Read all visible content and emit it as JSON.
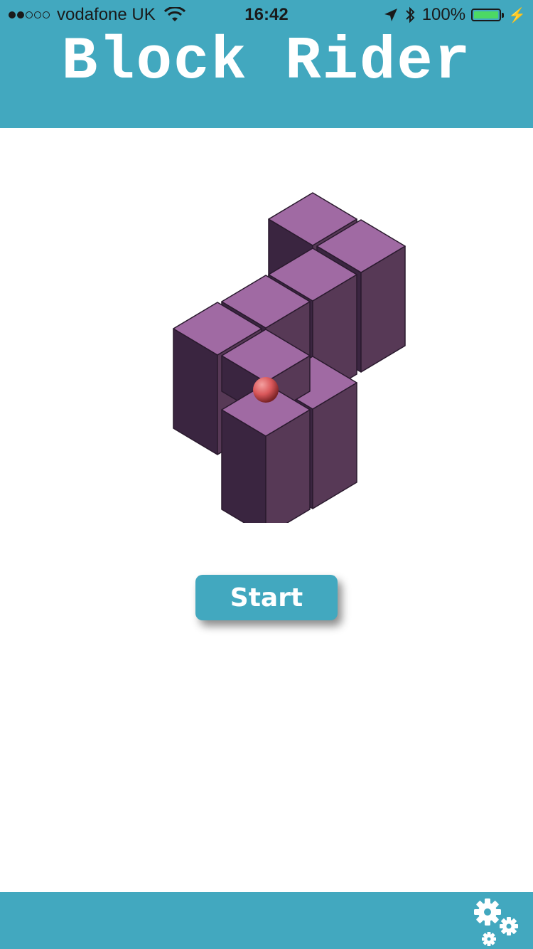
{
  "status_bar": {
    "signal": "●●○○○",
    "carrier": "vodafone UK",
    "time": "16:42",
    "battery": "100%"
  },
  "header": {
    "title": "Block Rider"
  },
  "main": {
    "start_label": "Start"
  },
  "footer": {
    "settings_icon": "gears-icon"
  },
  "colors": {
    "accent": "#42a8bf",
    "block_top": "#a06aa3",
    "block_left": "#3a2540",
    "block_right": "#573956",
    "ball": "#d9575a"
  }
}
